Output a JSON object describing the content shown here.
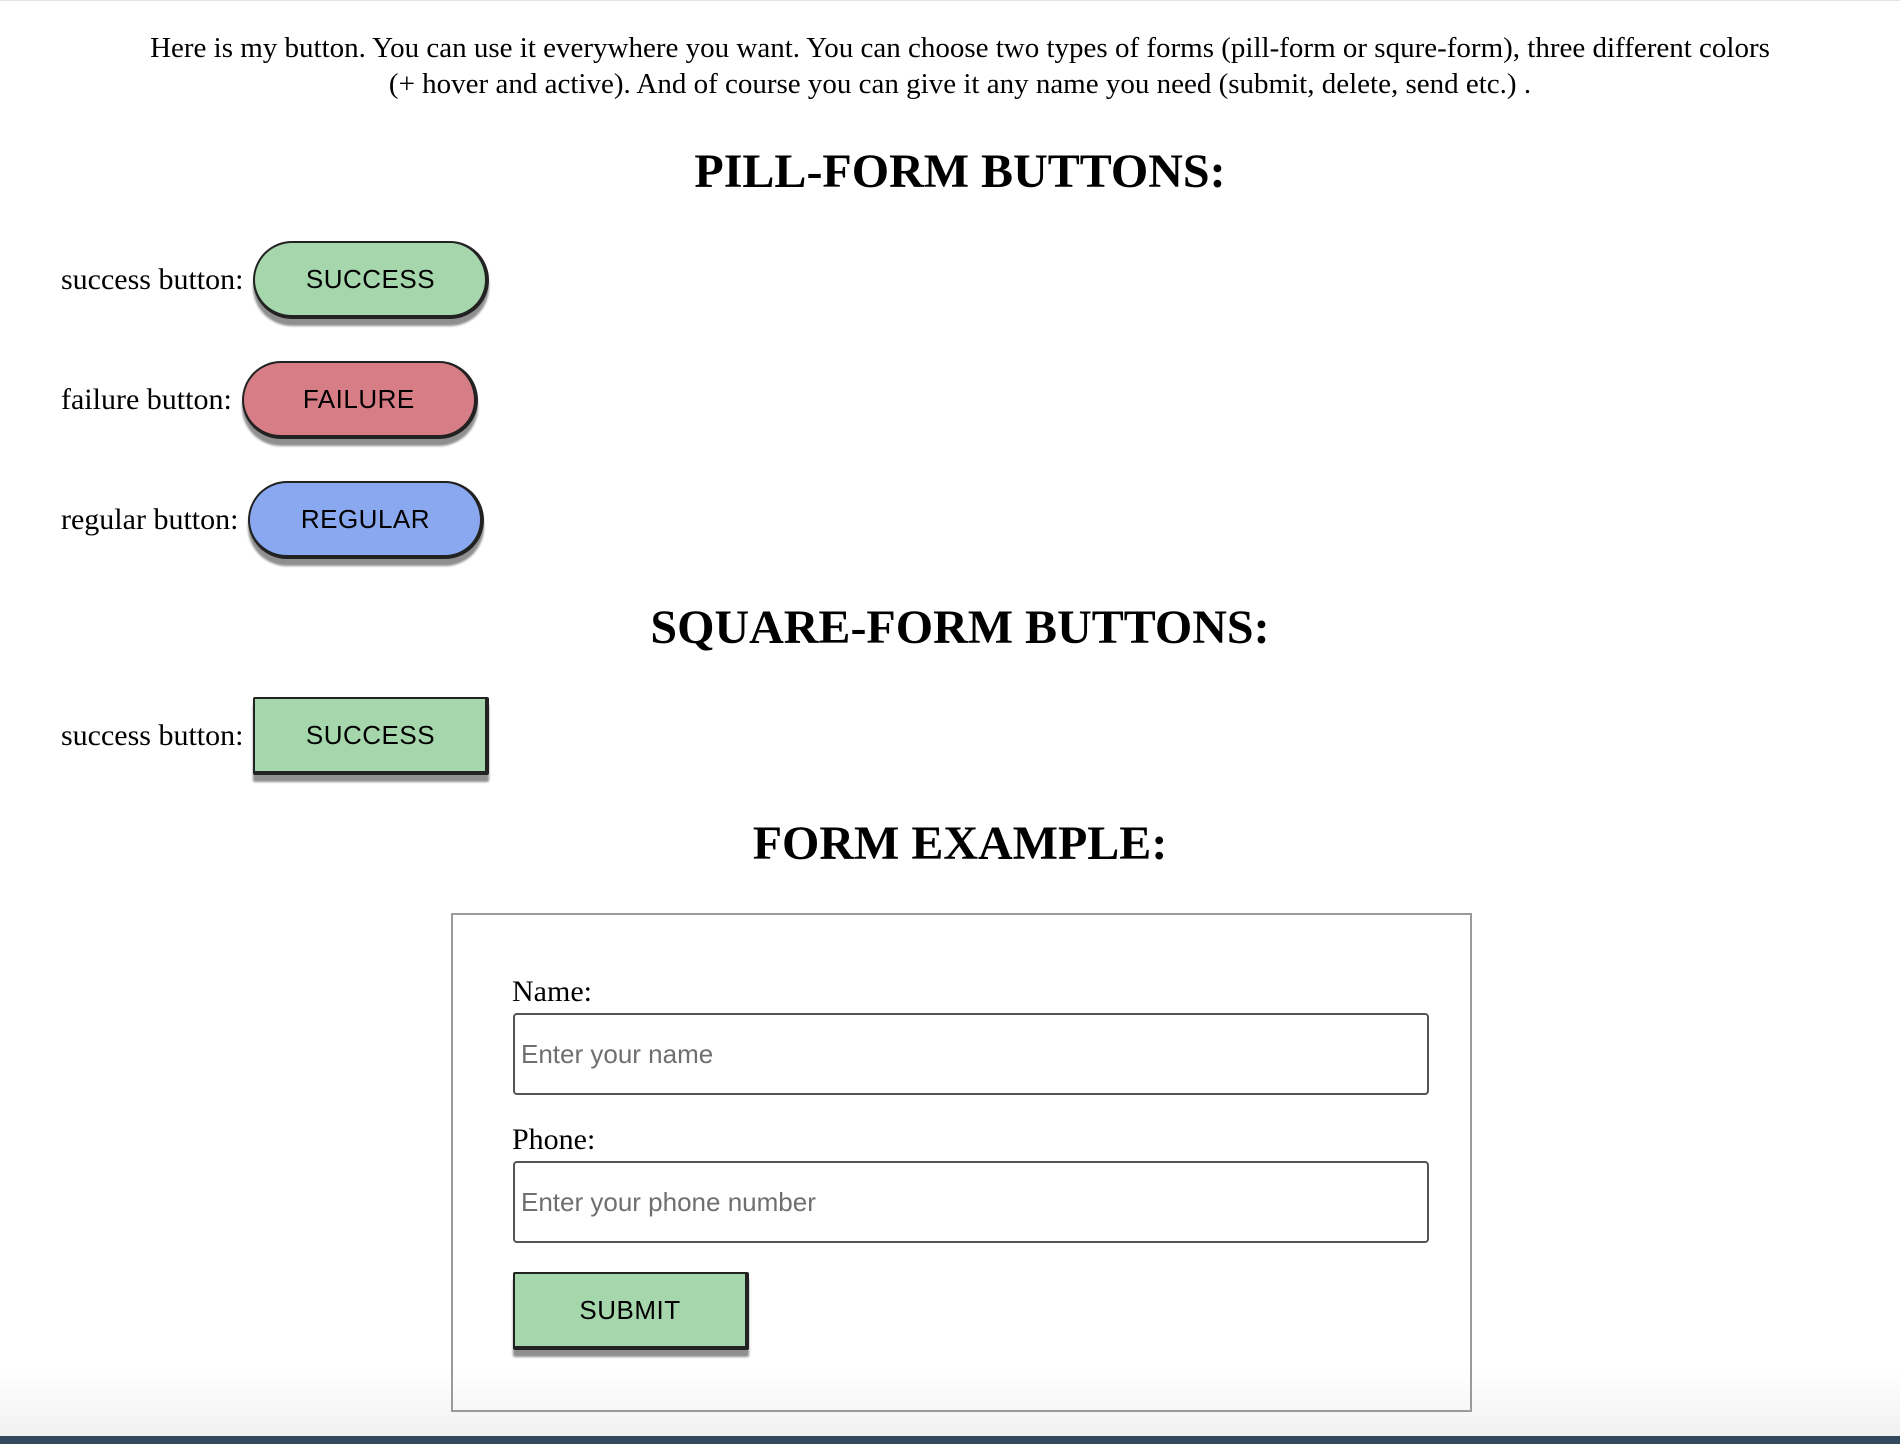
{
  "intro": {
    "line1": "Here is my button. You can use it everywhere you want. You can choose two types of forms (pill-form or squre-form), three different colors",
    "line2": "(+ hover and active). And of course you can give it any name you need (submit, delete, send etc.) ."
  },
  "pill_section": {
    "title": "PILL-FORM BUTTONS:",
    "rows": [
      {
        "label": "success button:",
        "button": "SUCCESS",
        "color": "#a5d6ac"
      },
      {
        "label": "failure button:",
        "button": "FAILURE",
        "color": "#d77d86"
      },
      {
        "label": "regular button:",
        "button": "REGULAR",
        "color": "#8aa8f0"
      }
    ]
  },
  "square_section": {
    "title": "SQUARE-FORM BUTTONS:",
    "rows": [
      {
        "label": "success button:",
        "button": "SUCCESS",
        "color": "#a5d6ac"
      }
    ]
  },
  "form_section": {
    "title": "FORM EXAMPLE:",
    "name_label": "Name:",
    "name_placeholder": "Enter your name",
    "name_value": "",
    "phone_label": "Phone:",
    "phone_placeholder": "Enter your phone number",
    "phone_value": "",
    "submit_label": "SUBMIT"
  },
  "colors": {
    "success": "#a5d6ac",
    "failure": "#d77d86",
    "regular": "#8aa8f0",
    "bottom_bar": "#34495e"
  }
}
